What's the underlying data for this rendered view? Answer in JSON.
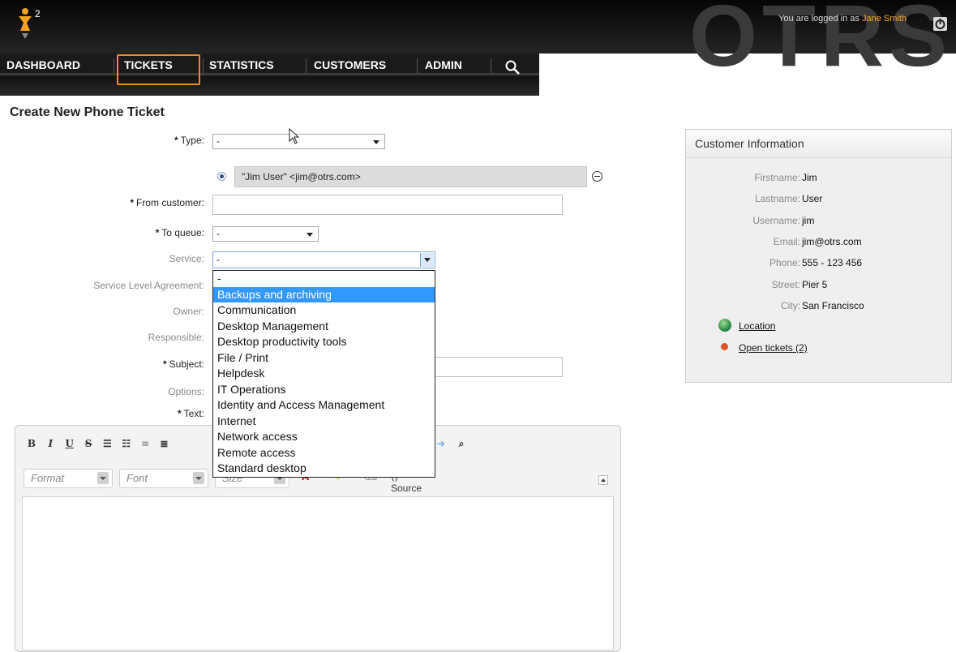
{
  "header": {
    "badge": "2",
    "login_prefix": "You are logged in as ",
    "login_user": "Jane Smith",
    "brand_text": "OTRS",
    "nav": [
      {
        "label": "DASHBOARD"
      },
      {
        "label": "TICKETS"
      },
      {
        "label": "STATISTICS"
      },
      {
        "label": "CUSTOMERS"
      },
      {
        "label": "ADMIN"
      }
    ]
  },
  "page": {
    "title": "Create New Phone Ticket"
  },
  "form": {
    "type_label": "Type:",
    "type_value": "-",
    "customer_chip": "\"Jim User\" <jim@otrs.com>",
    "from_customer_label": "From customer:",
    "to_queue_label": "To queue:",
    "to_queue_value": "-",
    "service_label": "Service:",
    "service_value": "-",
    "sla_label": "Service Level Agreement:",
    "owner_label": "Owner:",
    "responsible_label": "Responsible:",
    "subject_label": "Subject:",
    "options_label": "Options:",
    "text_label": "Text:"
  },
  "service_options": [
    "-",
    "Backups and archiving",
    "Communication",
    "Desktop Management",
    "Desktop productivity tools",
    "File / Print",
    "Helpdesk",
    "IT Operations",
    "Identity and Access Management",
    "Internet",
    "Network access",
    "Remote access",
    "Standard desktop"
  ],
  "service_selected_index": 1,
  "editor": {
    "format_placeholder": "Format",
    "font_placeholder": "Font",
    "size_placeholder": "Size",
    "source_label": "Source"
  },
  "customer_info": {
    "title": "Customer Information",
    "fields": [
      {
        "key": "Firstname:",
        "value": "Jim"
      },
      {
        "key": "Lastname:",
        "value": "User"
      },
      {
        "key": "Username:",
        "value": "jim"
      },
      {
        "key": "Email:",
        "value": "jim@otrs.com"
      },
      {
        "key": "Phone:",
        "value": "555 - 123 456"
      },
      {
        "key": "Street:",
        "value": "Pier 5"
      },
      {
        "key": "City:",
        "value": "San Francisco"
      }
    ],
    "location_link": "Location",
    "open_tickets_link": "Open tickets (2)"
  },
  "colors": {
    "accent": "#f08a1e",
    "selection": "#3399ff",
    "user_name": "#f7a42c"
  }
}
